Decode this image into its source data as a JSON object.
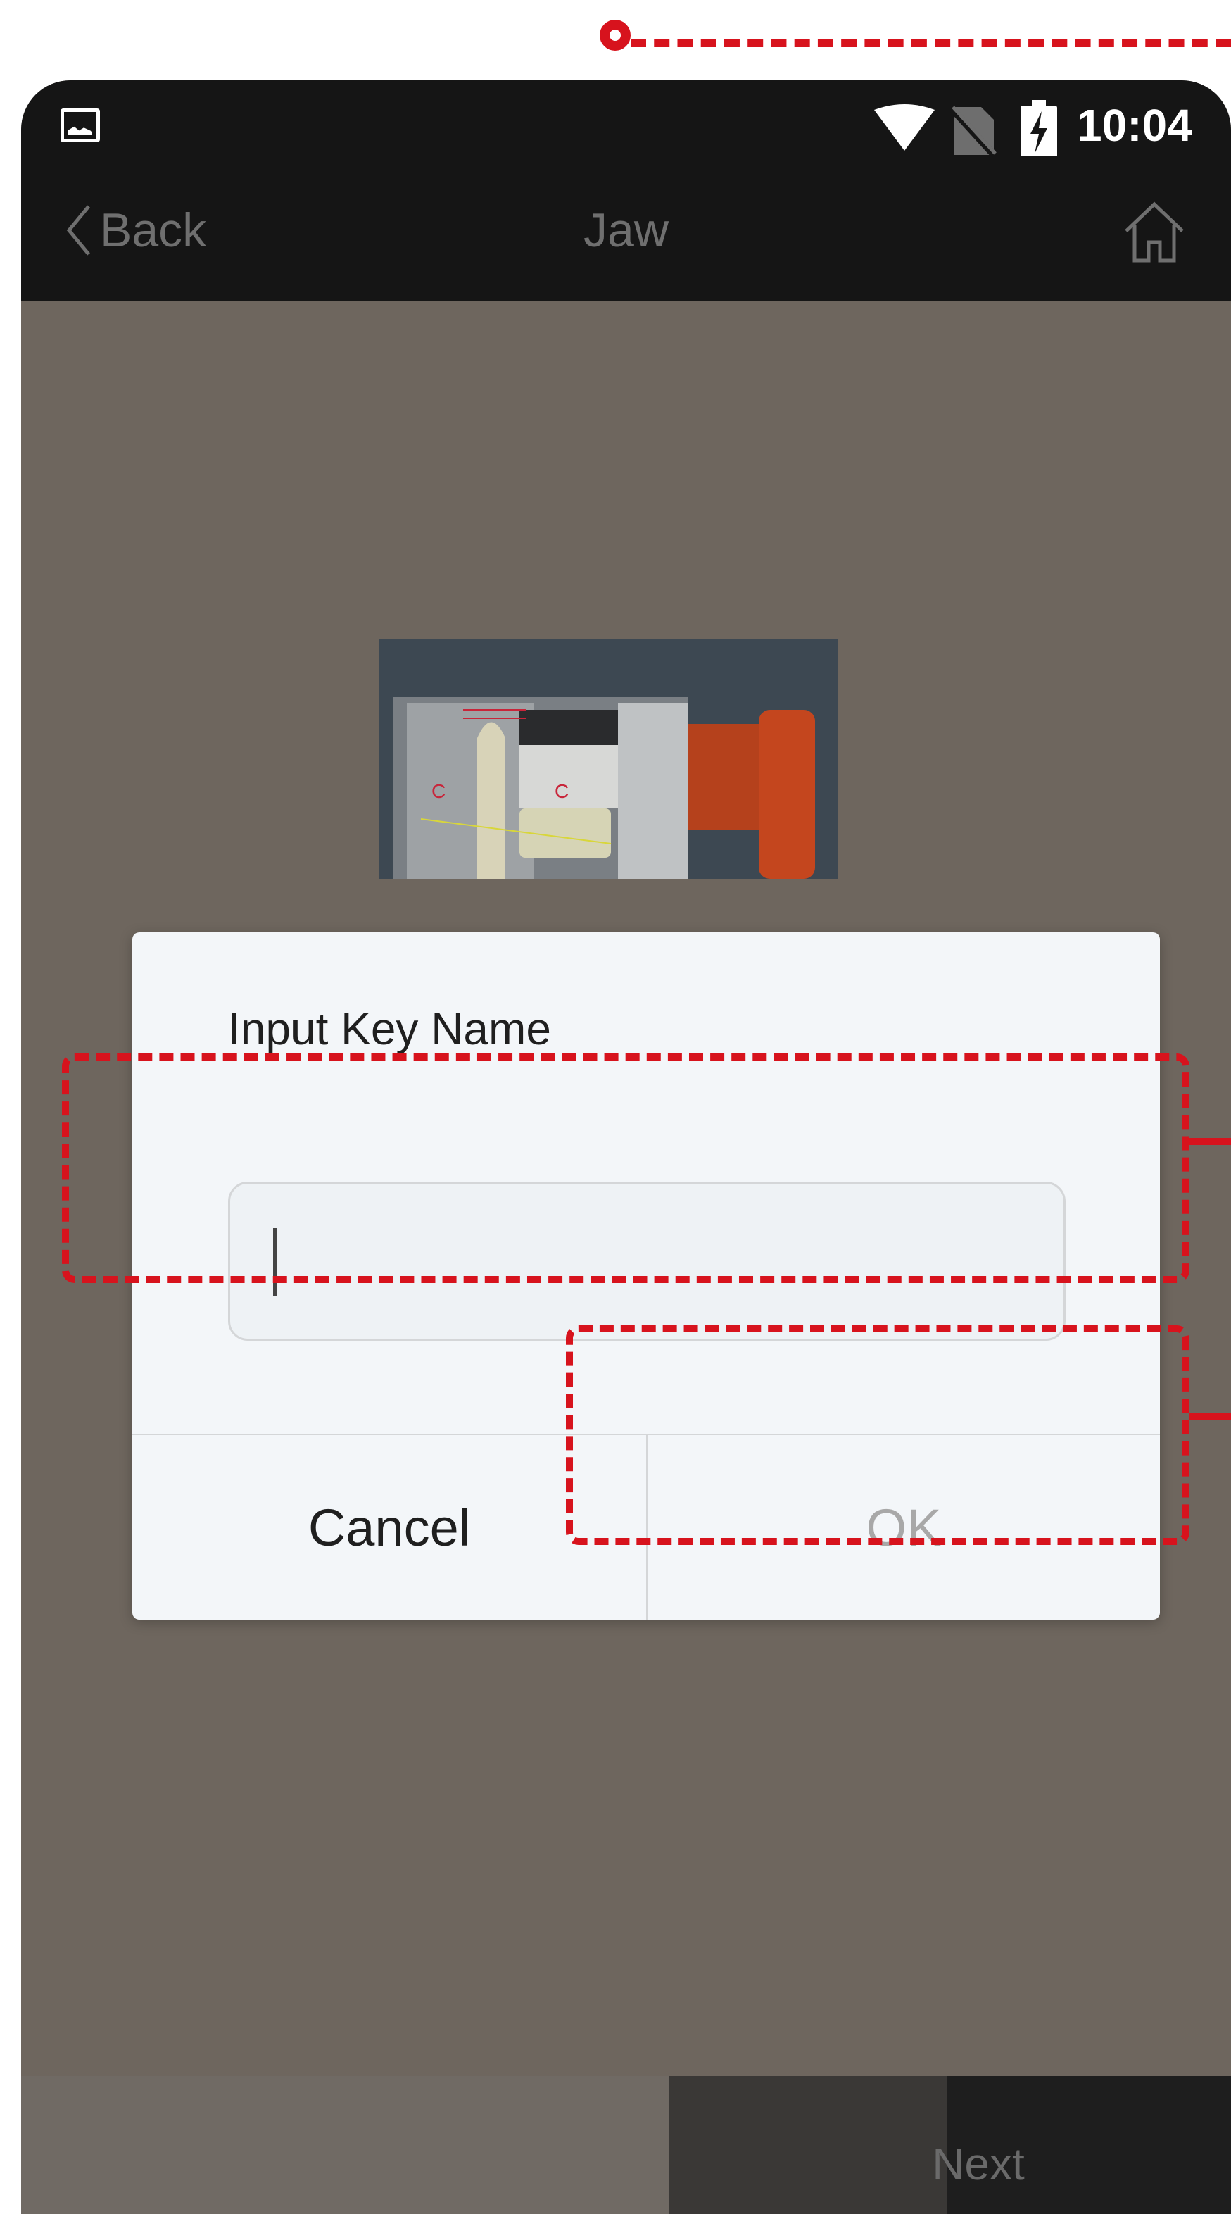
{
  "status_bar": {
    "time": "10:04",
    "icons": [
      "image-icon",
      "wifi-icon",
      "no-sim-icon",
      "battery-charging-icon"
    ]
  },
  "nav": {
    "back_label": "Back",
    "title": "Jaw",
    "home_icon": "home-icon"
  },
  "preview": {
    "marks": [
      "C",
      "C"
    ]
  },
  "dialog": {
    "title": "Input Key Name",
    "input_value": "",
    "cancel_label": "Cancel",
    "ok_label": "OK"
  },
  "footer": {
    "next_label": "Next"
  },
  "colors": {
    "annotation": "#d7131d",
    "bar_dark": "#151515",
    "backdrop": "#6e665e",
    "dialog_bg": "#f3f6f9",
    "disabled_text": "#a8a8a8"
  }
}
